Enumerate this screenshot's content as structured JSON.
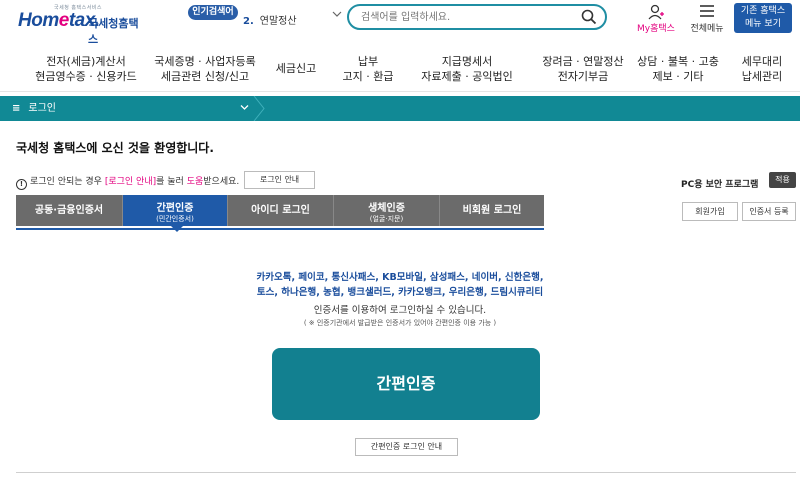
{
  "header": {
    "logo_small": "국세청 홈택스서비스",
    "logo_brand_pre": "Hom",
    "logo_brand_e": "e",
    "logo_brand_post": "tax.",
    "logo_sub": "국세청홈택스",
    "popular_label": "인기검색어",
    "popular_rank": "2.",
    "popular_term": "연말정산",
    "search_placeholder": "검색어를 입력하세요.",
    "my_hometax": "My홈택스",
    "all_menu": "전체메뉴",
    "legacy_line1": "기존 홈택스",
    "legacy_line2": "메뉴 보기"
  },
  "gnb": [
    {
      "line1": "전자(세금)계산서",
      "line2": "현금영수증 · 신용카드"
    },
    {
      "line1": "국세증명 · 사업자등록",
      "line2": "세금관련 신청/신고"
    },
    {
      "line1": "세금신고",
      "line2": ""
    },
    {
      "line1": "납부",
      "line2": "고지 · 환급"
    },
    {
      "line1": "지급명세서",
      "line2": "자료제출 · 공익법인"
    },
    {
      "line1": "장려금 · 연말정산",
      "line2": "전자기부금"
    },
    {
      "line1": "상담 · 불복 · 고충",
      "line2": "제보 · 기타"
    },
    {
      "line1": "세무대리",
      "line2": "납세관리"
    }
  ],
  "nav": {
    "menu_icon": "≡",
    "current": "로그인"
  },
  "welcome": "국세청 홈택스에 오신 것을 환영합니다.",
  "notice": {
    "pre": "로그인 안되는 경우",
    "link1": "[로그인 안내]",
    "mid": "를 눌러",
    "link2": "도움",
    "post": "받으세요.",
    "button": "로그인 안내"
  },
  "security": {
    "label": "PC용 보안 프로그램",
    "button": "적용"
  },
  "tabs": [
    {
      "main": "공동·금융인증서",
      "sub": "",
      "active": false
    },
    {
      "main": "간편인증",
      "sub": "(민간인증서)",
      "active": true
    },
    {
      "main": "아이디 로그인",
      "sub": "",
      "active": false
    },
    {
      "main": "생체인증",
      "sub": "(얼굴·지문)",
      "active": false
    },
    {
      "main": "비회원 로그인",
      "sub": "",
      "active": false
    }
  ],
  "side_buttons": {
    "signup": "회원가입",
    "cert_register": "인증서 등록"
  },
  "content": {
    "providers_line1": "카카오톡, 페이코, 통신사패스, KB모바일, 삼성패스, 네이버, 신한은행,",
    "providers_line2": "토스, 하나은행, 농협, 뱅크샐러드, 카카오뱅크, 우리은행, 드림시큐리티",
    "desc1": "인증서를 이용하여 로그인하실 수 있습니다.",
    "desc2": "( ※ 인증기관에서 발급받은 인증서가 있어야 간편인증 이용 가능 )",
    "main_button": "간편인증",
    "guide_button": "간편인증 로그인 안내"
  },
  "colors": {
    "brand_blue": "#1f5aa8",
    "teal": "#118995",
    "button_teal": "#128090",
    "accent_pink": "#e3007f",
    "tab_gray": "#6b6b6b"
  }
}
